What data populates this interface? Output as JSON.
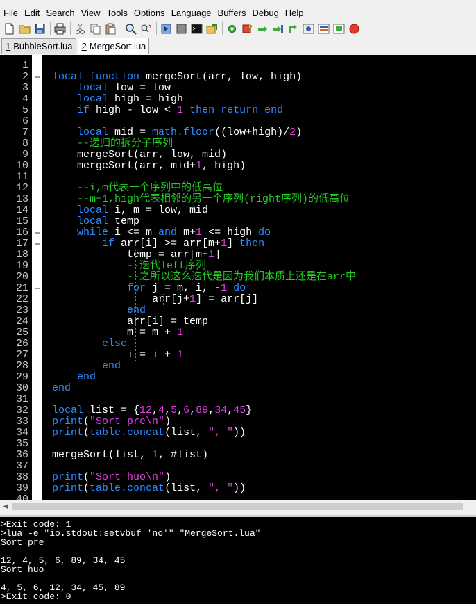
{
  "menu": [
    "File",
    "Edit",
    "Search",
    "View",
    "Tools",
    "Options",
    "Language",
    "Buffers",
    "Debug",
    "Help"
  ],
  "toolbar": [
    {
      "icon": "new-file-icon"
    },
    {
      "icon": "open-folder-icon"
    },
    {
      "icon": "save-icon"
    },
    {
      "sep": true
    },
    {
      "icon": "print-icon"
    },
    {
      "sep": true
    },
    {
      "icon": "cut-icon"
    },
    {
      "icon": "copy-icon"
    },
    {
      "icon": "paste-icon"
    },
    {
      "sep": true
    },
    {
      "icon": "find-icon"
    },
    {
      "icon": "replace-icon"
    },
    {
      "sep": true
    },
    {
      "icon": "compile-icon"
    },
    {
      "icon": "build-icon"
    },
    {
      "icon": "terminal-icon"
    },
    {
      "icon": "export-icon"
    },
    {
      "sep": true
    },
    {
      "icon": "debug-settings-icon"
    },
    {
      "icon": "toggle-breakpoint-icon"
    },
    {
      "icon": "step-over-icon"
    },
    {
      "icon": "step-into-icon"
    },
    {
      "icon": "step-out-icon"
    },
    {
      "icon": "watch-icon"
    },
    {
      "icon": "variables-icon"
    },
    {
      "icon": "stack-icon"
    },
    {
      "icon": "stop-icon"
    }
  ],
  "tabs": [
    {
      "num": "1",
      "label": "BubbleSort.lua",
      "active": false
    },
    {
      "num": "2",
      "label": "MergeSort.lua",
      "active": true
    }
  ],
  "code_lines": [
    [],
    [
      [
        "k",
        "local "
      ],
      [
        "k",
        "function "
      ],
      [
        "i",
        "mergeSort(arr, low, high)"
      ]
    ],
    [
      [
        "i",
        "    "
      ],
      [
        "k",
        "local "
      ],
      [
        "i",
        "low = low"
      ]
    ],
    [
      [
        "i",
        "    "
      ],
      [
        "k",
        "local "
      ],
      [
        "i",
        "high = high"
      ]
    ],
    [
      [
        "i",
        "    "
      ],
      [
        "k",
        "if "
      ],
      [
        "i",
        "high - low < "
      ],
      [
        "n",
        "1"
      ],
      [
        "i",
        " "
      ],
      [
        "k",
        "then return end"
      ]
    ],
    [],
    [
      [
        "i",
        "    "
      ],
      [
        "k",
        "local "
      ],
      [
        "i",
        "mid = "
      ],
      [
        "k",
        "math.floor"
      ],
      [
        "i",
        "((low+high)/"
      ],
      [
        "n",
        "2"
      ],
      [
        "i",
        ")"
      ]
    ],
    [
      [
        "i",
        "    "
      ],
      [
        "c",
        "--递归的拆分子序列"
      ]
    ],
    [
      [
        "i",
        "    mergeSort(arr, low, mid)"
      ]
    ],
    [
      [
        "i",
        "    mergeSort(arr, mid+"
      ],
      [
        "n",
        "1"
      ],
      [
        "i",
        ", high)"
      ]
    ],
    [],
    [
      [
        "i",
        "    "
      ],
      [
        "c",
        "--i,m代表一个序列中的低高位"
      ]
    ],
    [
      [
        "i",
        "    "
      ],
      [
        "c",
        "--m+1,high代表相邻的另一个序列(right序列)的低高位"
      ]
    ],
    [
      [
        "i",
        "    "
      ],
      [
        "k",
        "local "
      ],
      [
        "i",
        "i, m = low, mid"
      ]
    ],
    [
      [
        "i",
        "    "
      ],
      [
        "k",
        "local "
      ],
      [
        "i",
        "temp"
      ]
    ],
    [
      [
        "i",
        "    "
      ],
      [
        "k",
        "while "
      ],
      [
        "i",
        "i <= m "
      ],
      [
        "k",
        "and "
      ],
      [
        "i",
        "m+"
      ],
      [
        "n",
        "1"
      ],
      [
        "i",
        " <= high "
      ],
      [
        "k",
        "do"
      ]
    ],
    [
      [
        "i",
        "        "
      ],
      [
        "k",
        "if "
      ],
      [
        "i",
        "arr[i] >= arr[m+"
      ],
      [
        "n",
        "1"
      ],
      [
        "i",
        "] "
      ],
      [
        "k",
        "then"
      ]
    ],
    [
      [
        "i",
        "            temp = arr[m+"
      ],
      [
        "n",
        "1"
      ],
      [
        "i",
        "]"
      ]
    ],
    [
      [
        "i",
        "            "
      ],
      [
        "c",
        "--迭代left序列"
      ]
    ],
    [
      [
        "i",
        "            "
      ],
      [
        "c",
        "--之所以这么迭代是因为我们本质上还是在arr中"
      ]
    ],
    [
      [
        "i",
        "            "
      ],
      [
        "k",
        "for "
      ],
      [
        "i",
        "j = m, i, -"
      ],
      [
        "n",
        "1"
      ],
      [
        "i",
        " "
      ],
      [
        "k",
        "do"
      ]
    ],
    [
      [
        "i",
        "                arr[j+"
      ],
      [
        "n",
        "1"
      ],
      [
        "i",
        "] = arr[j]"
      ]
    ],
    [
      [
        "i",
        "            "
      ],
      [
        "k",
        "end"
      ]
    ],
    [
      [
        "i",
        "            arr[i] = temp"
      ]
    ],
    [
      [
        "i",
        "            m = m + "
      ],
      [
        "n",
        "1"
      ]
    ],
    [
      [
        "i",
        "        "
      ],
      [
        "k",
        "else"
      ]
    ],
    [
      [
        "i",
        "            i = i + "
      ],
      [
        "n",
        "1"
      ]
    ],
    [
      [
        "i",
        "        "
      ],
      [
        "k",
        "end"
      ]
    ],
    [
      [
        "i",
        "    "
      ],
      [
        "k",
        "end"
      ]
    ],
    [
      [
        "k",
        "end"
      ]
    ],
    [],
    [
      [
        "k",
        "local "
      ],
      [
        "i",
        "list = {"
      ],
      [
        "n",
        "12"
      ],
      [
        "i",
        ","
      ],
      [
        "n",
        "4"
      ],
      [
        "i",
        ","
      ],
      [
        "n",
        "5"
      ],
      [
        "i",
        ","
      ],
      [
        "n",
        "6"
      ],
      [
        "i",
        ","
      ],
      [
        "n",
        "89"
      ],
      [
        "i",
        ","
      ],
      [
        "n",
        "34"
      ],
      [
        "i",
        ","
      ],
      [
        "n",
        "45"
      ],
      [
        "i",
        "}"
      ]
    ],
    [
      [
        "k",
        "print"
      ],
      [
        "i",
        "("
      ],
      [
        "s",
        "\"Sort pre\\n\""
      ],
      [
        "i",
        ")"
      ]
    ],
    [
      [
        "k",
        "print"
      ],
      [
        "i",
        "("
      ],
      [
        "k",
        "table.concat"
      ],
      [
        "i",
        "(list, "
      ],
      [
        "s",
        "\", \""
      ],
      [
        "i",
        "))"
      ]
    ],
    [],
    [
      [
        "i",
        "mergeSort(list, "
      ],
      [
        "n",
        "1"
      ],
      [
        "i",
        ", #list)"
      ]
    ],
    [],
    [
      [
        "k",
        "print"
      ],
      [
        "i",
        "("
      ],
      [
        "s",
        "\"Sort huo\\n\""
      ],
      [
        "i",
        ")"
      ]
    ],
    [
      [
        "k",
        "print"
      ],
      [
        "i",
        "("
      ],
      [
        "k",
        "table.concat"
      ],
      [
        "i",
        "(list, "
      ],
      [
        "s",
        "\", \""
      ],
      [
        "i",
        "))"
      ]
    ],
    []
  ],
  "output_lines": [
    ">Exit code: 1",
    ">lua -e \"io.stdout:setvbuf 'no'\" \"MergeSort.lua\"",
    "Sort pre",
    "",
    "12, 4, 5, 6, 89, 34, 45",
    "Sort huo",
    "",
    "4, 5, 6, 12, 34, 45, 89",
    ">Exit code: 0"
  ],
  "colors": {
    "keyword": "#2f8bff",
    "number_string": "#e040e0",
    "comment": "#22cc22",
    "identifier": "#ffffff",
    "background": "#000000"
  }
}
